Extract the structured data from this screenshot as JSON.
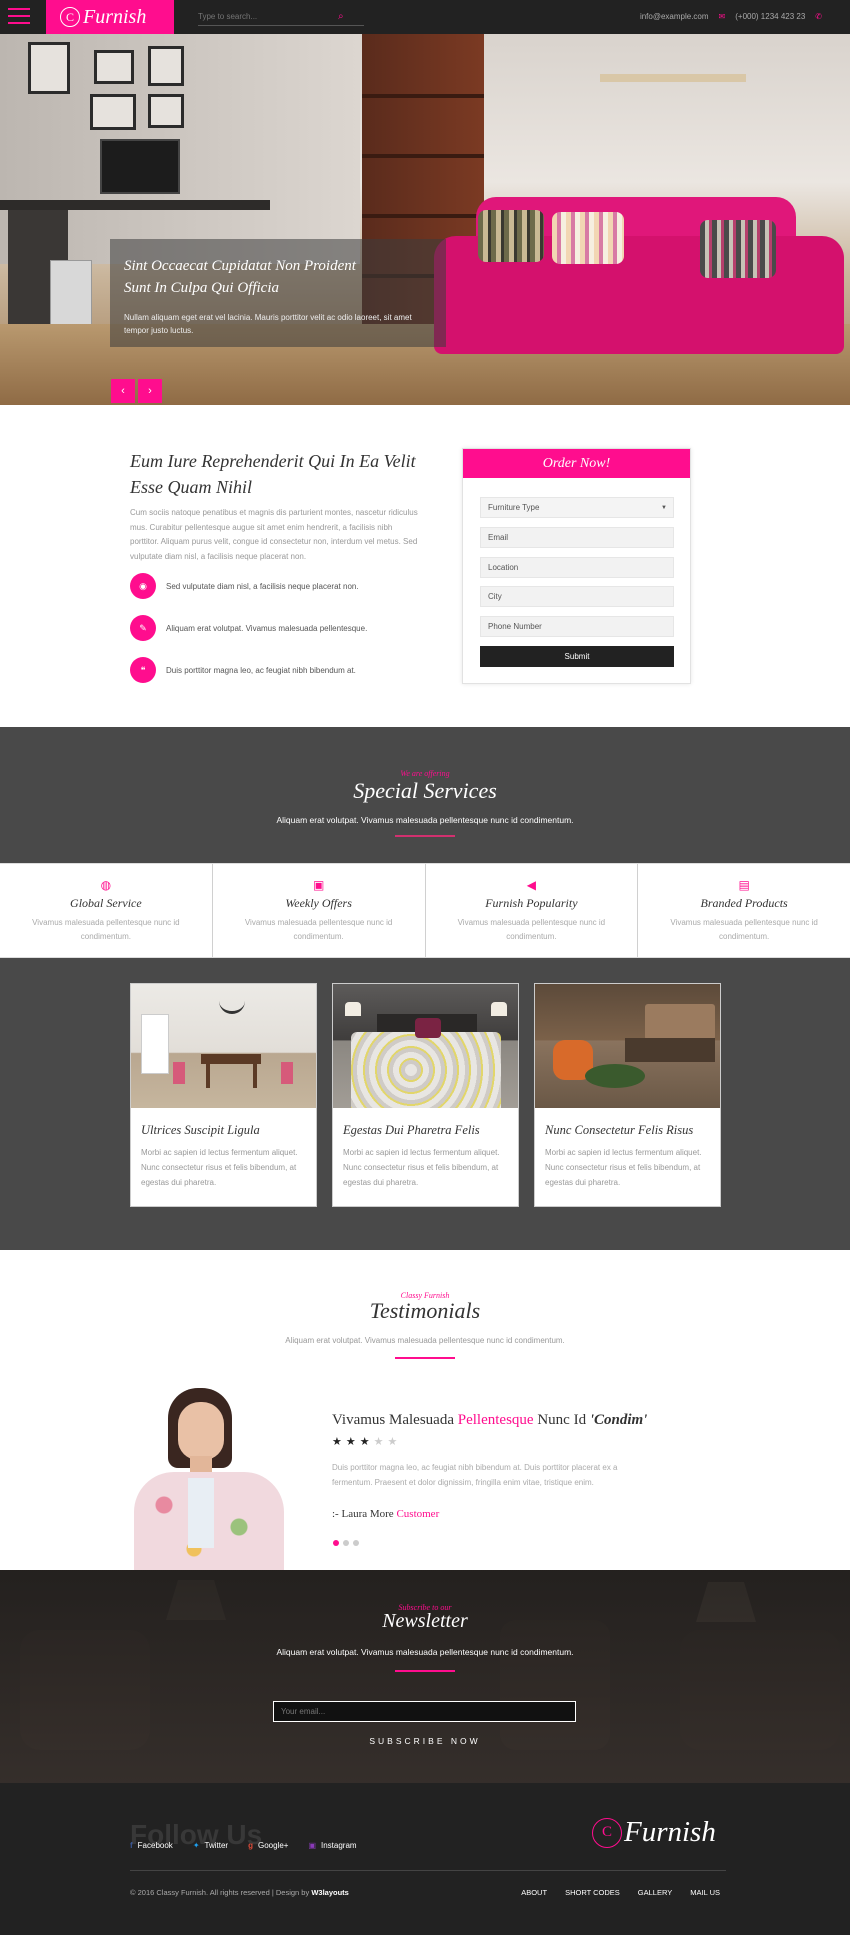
{
  "header": {
    "logo_letter": "C",
    "logo_text": "Furnish",
    "search_placeholder": "Type to search...",
    "email": "info@example.com",
    "phone": "(+000) 1234 423 23"
  },
  "hero": {
    "title_line1": "Sint Occaecat Cupidatat Non Proident",
    "title_line2": "Sunt In Culpa Qui Officia",
    "text": "Nullam aliquam eget erat vel lacinia. Mauris porttitor velit ac odio laoreet, sit amet tempor justo luctus.",
    "prev": "‹",
    "next": "›"
  },
  "about": {
    "heading_line1": "Eum Iure Reprehenderit Qui In Ea Velit",
    "heading_line2": "Esse Quam Nihil",
    "paragraph": "Cum sociis natoque penatibus et magnis dis parturient montes, nascetur ridiculus mus. Curabitur pellentesque augue sit amet enim hendrerit, a facilisis nibh porttitor. Aliquam purus velit, congue id consectetur non, interdum vel metus. Sed vulputate diam nisl, a facilisis neque placerat non.",
    "features": [
      {
        "text": "Sed vulputate diam nisl, a facilisis neque placerat non.",
        "icon": "eye-icon"
      },
      {
        "text": "Aliquam erat volutpat. Vivamus malesuada pellentesque.",
        "icon": "pencil-icon"
      },
      {
        "text": "Duis porttitor magna leo, ac feugiat nibh bibendum at.",
        "icon": "chat-icon"
      }
    ]
  },
  "order": {
    "title": "Order Now!",
    "select_value": "Furniture Type",
    "fields": [
      "Email",
      "Location",
      "City",
      "Phone Number"
    ],
    "submit": "Submit"
  },
  "services": {
    "small": "We are offering",
    "title": "Special Services",
    "subtitle": "Aliquam erat volutpat. Vivamus malesuada pellentesque nunc id condimentum.",
    "items": [
      {
        "title": "Global Service",
        "text": "Vivamus malesuada pellentesque nunc id condimentum.",
        "icon": "globe-icon"
      },
      {
        "title": "Weekly Offers",
        "text": "Vivamus malesuada pellentesque nunc id condimentum.",
        "icon": "gift-icon"
      },
      {
        "title": "Furnish Popularity",
        "text": "Vivamus malesuada pellentesque nunc id condimentum.",
        "icon": "megaphone-icon"
      },
      {
        "title": "Branded Products",
        "text": "Vivamus malesuada pellentesque nunc id condimentum.",
        "icon": "printer-icon"
      }
    ]
  },
  "cards": [
    {
      "title": "Ultrices Suscipit Ligula",
      "text": "Morbi ac sapien id lectus fermentum aliquet. Nunc consectetur risus et felis bibendum, at egestas dui pharetra."
    },
    {
      "title": "Egestas Dui Pharetra Felis",
      "text": "Morbi ac sapien id lectus fermentum aliquet. Nunc consectetur risus et felis bibendum, at egestas dui pharetra."
    },
    {
      "title": "Nunc Consectetur Felis Risus",
      "text": "Morbi ac sapien id lectus fermentum aliquet. Nunc consectetur risus et felis bibendum, at egestas dui pharetra."
    }
  ],
  "testimonials": {
    "small": "Classy Furnish",
    "title": "Testimonials",
    "subtitle": "Aliquam erat volutpat. Vivamus malesuada pellentesque nunc id condimentum.",
    "quote_start": "Vivamus Malesuada ",
    "quote_highlight": "Pellentesque",
    "quote_mid": " Nunc Id ",
    "quote_end": "'Condim'",
    "rating": 3,
    "rating_max": 5,
    "body": "Duis porttitor magna leo, ac feugiat nibh bibendum at. Duis porttitor placerat ex a fermentum. Praesent et dolor dignissim, fringilla enim vitae, tristique enim.",
    "author_prefix": ":- Laura More ",
    "author_role": "Customer"
  },
  "newsletter": {
    "small": "Subscribe to our",
    "title": "Newsletter",
    "subtitle": "Aliquam erat volutpat. Vivamus malesuada pellentesque nunc id condimentum.",
    "placeholder": "Your email...",
    "button": "SUBSCRIBE NOW"
  },
  "footer": {
    "follow": "Follow Us",
    "socials": [
      {
        "label": "Facebook",
        "icon": "facebook-icon",
        "color": "#3b5998"
      },
      {
        "label": "Twitter",
        "icon": "twitter-icon",
        "color": "#1da1f2"
      },
      {
        "label": "Google+",
        "icon": "googleplus-icon",
        "color": "#dd4b39"
      },
      {
        "label": "Instagram",
        "icon": "instagram-icon",
        "color": "#8a3ab9"
      }
    ],
    "logo_letter": "C",
    "logo_text": "Furnish",
    "copyright": "© 2016 Classy Furnish. All rights reserved | Design by ",
    "designer": "W3layouts",
    "nav": [
      "ABOUT",
      "SHORT CODES",
      "GALLERY",
      "MAIL US"
    ]
  },
  "colors": {
    "accent": "#ff0d8e",
    "dark": "#222222",
    "section_gray": "#494949"
  }
}
